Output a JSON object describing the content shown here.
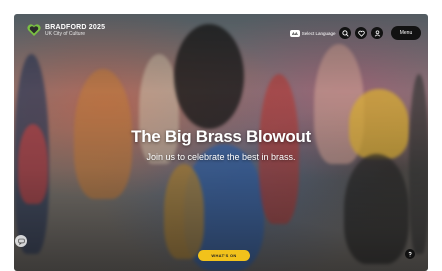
{
  "brand": {
    "title": "BRADFORD 2025",
    "subtitle": "UK City of Culture",
    "logo_icon": "heart-logo-icon",
    "accent": "#7ac142"
  },
  "header": {
    "language_badge": "AA",
    "language_label": "Select Language",
    "search_icon": "search-icon",
    "favourite_icon": "heart-icon",
    "account_icon": "user-icon",
    "menu_label": "Menu"
  },
  "hero": {
    "headline": "The Big Brass Blowout",
    "subline": "Join us to celebrate the best in brass.",
    "cta_label": "WHAT'S ON",
    "cta_color": "#f2c21b"
  },
  "widgets": {
    "chat_icon": "chat-icon",
    "corner_icon": "help-icon"
  }
}
